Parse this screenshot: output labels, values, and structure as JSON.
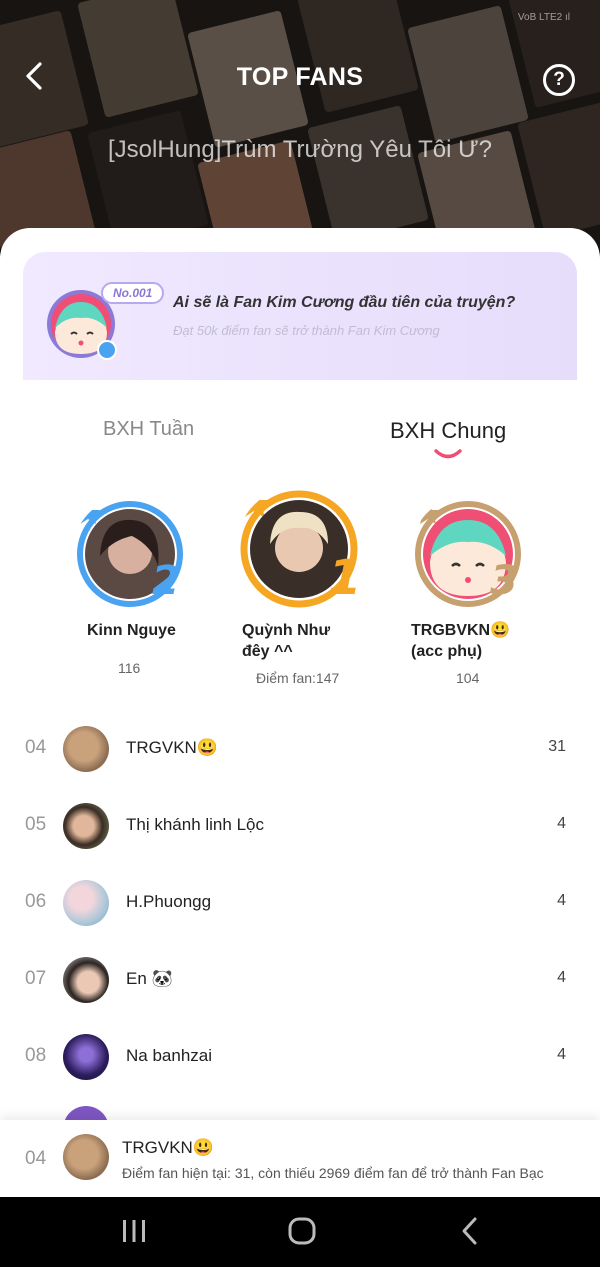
{
  "status": {
    "signal": "VoB LTE2 ıl"
  },
  "header": {
    "title": "TOP FANS",
    "story_title": "[JsolHung]Trùm Trường Yêu Tôi Ư?",
    "help_label": "?"
  },
  "banner": {
    "tag": "No.001",
    "headline": "Ai sẽ là Fan Kim Cương đầu tiên của truyện?",
    "subline": "Đạt 50k điểm fan sẽ trở thành Fan Kim Cương"
  },
  "tabs": [
    {
      "label": "BXH Tuần",
      "active": false
    },
    {
      "label": "BXH Chung",
      "active": true
    }
  ],
  "podium": [
    {
      "rank": "2",
      "name": "Kinn Nguye",
      "score": "116",
      "ring": "#4aa3f0"
    },
    {
      "rank": "1",
      "name_line1": "Quỳnh Như",
      "name_line2": "đêy ^^",
      "score": "Điểm fan:147",
      "ring": "#f5a623"
    },
    {
      "rank": "3",
      "name_line1": "TRGBVKN😃",
      "name_line2": "(acc phụ)",
      "score": "104",
      "ring": "#c7a070"
    }
  ],
  "ranking": [
    {
      "rank": "04",
      "name": "TRGVKN😃",
      "score": "31"
    },
    {
      "rank": "05",
      "name": "Thị khánh linh Lộc",
      "score": "4"
    },
    {
      "rank": "06",
      "name": "H.Phuongg",
      "score": "4"
    },
    {
      "rank": "07",
      "name": "En 🐼",
      "score": "4"
    },
    {
      "rank": "08",
      "name": "Na banhzai",
      "score": "4"
    }
  ],
  "me": {
    "rank": "04",
    "name": "TRGVKN😃",
    "note": "Điểm fan hiện tại: 31, còn thiếu 2969 điểm fan để trở thành Fan Bạc"
  },
  "colors": {
    "accent_pink": "#ef4f74",
    "banner_bg": "#e9e1fc"
  }
}
